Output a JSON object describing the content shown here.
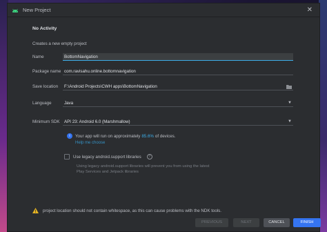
{
  "window": {
    "title": "New Project"
  },
  "heading": "No Activity",
  "subheading": "Creates a new empty project",
  "form": {
    "name_label": "Name",
    "name_value": "BottomNavigation",
    "package_label": "Package name",
    "package_value": "com.ravisahu.online.bottomnavigation",
    "save_label": "Save location",
    "save_value": "F:\\Android Projects\\CWH apps\\BottomNavigation",
    "language_label": "Language",
    "language_value": "Java",
    "sdk_label": "Minimum SDK",
    "sdk_value": "API 23: Android 6.0 (Marshmallow)"
  },
  "info": {
    "prefix": "Your app will run on approximately",
    "percent": "85.6%",
    "suffix": "of devices.",
    "help_link": "Help me choose"
  },
  "legacy": {
    "label": "Use legacy android.support libraries",
    "description": "Using legacy android.support libraries will prevent you from using the latest Play Services and Jetpack libraries"
  },
  "warning": "project location should not contain whitespace, as this can cause problems with the NDK tools.",
  "buttons": {
    "previous": "PREVIOUS",
    "next": "NEXT",
    "cancel": "CANCEL",
    "finish": "FINISH"
  },
  "colors": {
    "accent": "#3574f0",
    "link": "#3592c4",
    "percent": "#3daee9",
    "warning": "#e6b422",
    "android": "#3ddc84"
  }
}
